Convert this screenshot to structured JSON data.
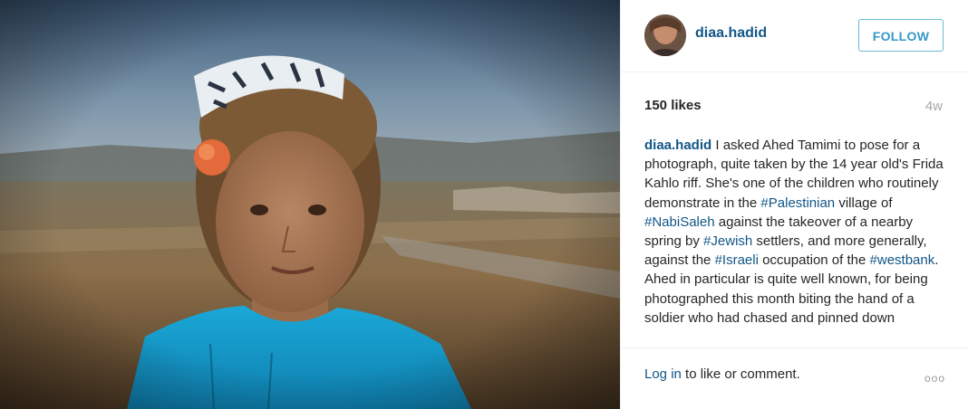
{
  "post": {
    "photo_alt": "",
    "username": "diaa.hadid",
    "follow_label": "FOLLOW",
    "likes": "150 likes",
    "age": "4w",
    "caption": {
      "username": "diaa.hadid",
      "segments": [
        {
          "text": " I asked Ahed Tamimi to pose for a photograph, quite taken by the 14 year old's Frida Kahlo riff. She's one of the children who routinely demonstrate in the ",
          "tag": false
        },
        {
          "text": "#Palestinian",
          "tag": true
        },
        {
          "text": " village of ",
          "tag": false
        },
        {
          "text": "#NabiSaleh",
          "tag": true
        },
        {
          "text": " against the takeover of a nearby spring by ",
          "tag": false
        },
        {
          "text": "#Jewish",
          "tag": true
        },
        {
          "text": " settlers, and more generally, against the ",
          "tag": false
        },
        {
          "text": "#Israeli",
          "tag": true
        },
        {
          "text": " occupation of the ",
          "tag": false
        },
        {
          "text": "#westbank",
          "tag": true
        },
        {
          "text": ". Ahed in particular is quite well known, for being photographed this month biting the hand of a soldier who had chased and pinned down",
          "tag": false
        }
      ]
    },
    "login_link": "Log in",
    "login_rest": " to like or comment.",
    "more_icon": "ooo"
  },
  "colors": {
    "link": "#125688",
    "follow_border": "#6bb9d1",
    "muted": "#a5a7aa"
  }
}
